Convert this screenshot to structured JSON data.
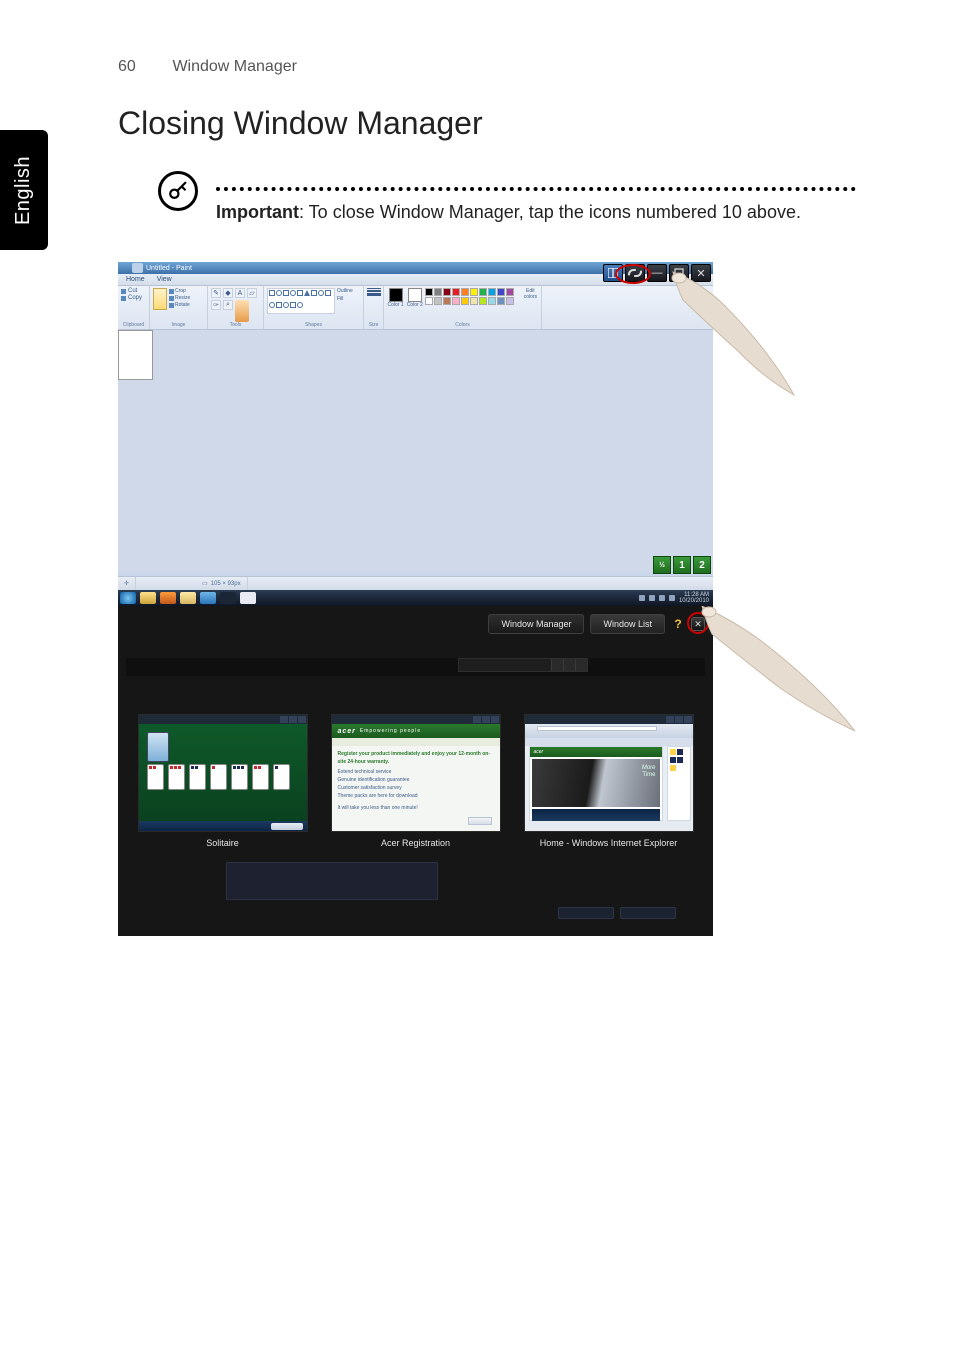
{
  "page": {
    "number": "60",
    "section": "Window Manager",
    "language_tab": "English"
  },
  "heading": "Closing Window Manager",
  "note": {
    "important_label": "Important",
    "text": ": To close Window Manager, tap the icons numbered 10 above."
  },
  "upper_app": {
    "title": "Untitled - Paint",
    "tabs": [
      "Home",
      "View"
    ],
    "clipboard": {
      "label": "Clipboard",
      "cut": "Cut",
      "copy": "Copy"
    },
    "image": {
      "label": "Image",
      "select": "Select",
      "crop": "Crop",
      "resize": "Resize",
      "rotate": "Rotate"
    },
    "tools": {
      "label": "Tools",
      "text_glyph": "A",
      "brushes": "Brushes"
    },
    "shapes": {
      "label": "Shapes",
      "outline": "Outline",
      "fill": "Fill"
    },
    "size": {
      "label": "Size"
    },
    "colors": {
      "label": "Colors",
      "color1": "Color 1",
      "color2": "Color 2",
      "edit": "Edit colors",
      "palette": [
        "#000000",
        "#7f7f7f",
        "#880015",
        "#ed1c24",
        "#ff7f27",
        "#fff200",
        "#22b14c",
        "#00a2e8",
        "#3f48cc",
        "#a349a4",
        "#ffffff",
        "#c3c3c3",
        "#b97a57",
        "#ffaec9",
        "#ffc90e",
        "#efe4b0",
        "#b5e61d",
        "#99d9ea",
        "#7092be",
        "#c8bfe7"
      ]
    },
    "status": {
      "dims": "105 × 93px"
    },
    "zoom_buttons": [
      "½",
      "1",
      "2"
    ]
  },
  "title_overlay": {
    "icons": [
      "layout-icon",
      "link-icon",
      "minimize-icon",
      "maximize-icon",
      "close-icon"
    ]
  },
  "taskbar": {
    "clock": {
      "time": "11:28 AM",
      "date": "10/20/2010"
    }
  },
  "wm_panel": {
    "tabs": {
      "manager": "Window Manager",
      "list": "Window List"
    },
    "help_glyph": "?",
    "close_glyph": "✕"
  },
  "thumbs": {
    "solitaire": {
      "title": "Solitaire"
    },
    "acer_reg": {
      "title": "Acer Registration",
      "brand": "acer",
      "tagline": "Empowering people",
      "headline": "Register your product immediately and enjoy your 12-month on-site 24-hour warranty.",
      "bullets": [
        "Extend technical service",
        "Genuine identification guarantee",
        "Customer satisfaction survey",
        "Theme packs are here for download"
      ],
      "footer": "It will take you less than one minute!"
    },
    "ie": {
      "title": "Home - Windows Internet Explorer",
      "brand": "acer",
      "hero_line1": "More",
      "hero_line2": "Time"
    }
  }
}
